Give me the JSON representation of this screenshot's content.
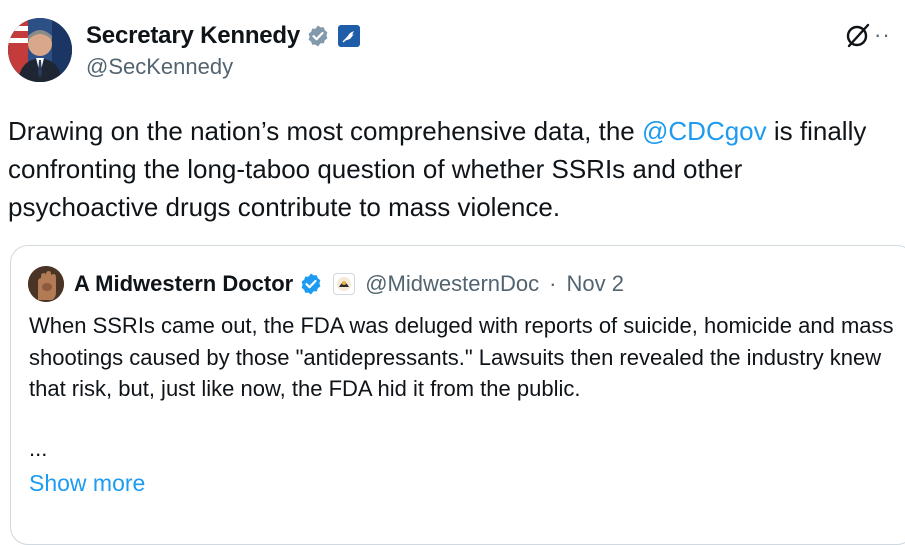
{
  "author": {
    "display_name": "Secretary Kennedy",
    "handle": "@SecKennedy",
    "verified_color": "#829aab",
    "affiliate_badge": "hhs-eagle-icon"
  },
  "tweet": {
    "text_before": "Drawing on the nation’s most comprehensive data, the ",
    "mention": "@CDCgov",
    "text_after": " is finally confronting the long-taboo question of whether SSRIs and other psychoactive drugs contribute to mass violence."
  },
  "quote": {
    "display_name": "A Midwestern Doctor",
    "handle": "@MidwesternDoc",
    "separator": "·",
    "date": "Nov 2",
    "verified_color": "#1d9bf0",
    "text": "When SSRIs came out, the FDA was deluged with reports of suicide, homicide and mass shootings caused by those \"antidepressants.\" Lawsuits then revealed the industry knew that risk, but, just like now, the FDA hid it from the public.",
    "ellipsis": "...",
    "show_more": "Show more"
  },
  "colors": {
    "link": "#1d9bf0",
    "secondary_text": "#536471",
    "border": "#cfd9de"
  }
}
